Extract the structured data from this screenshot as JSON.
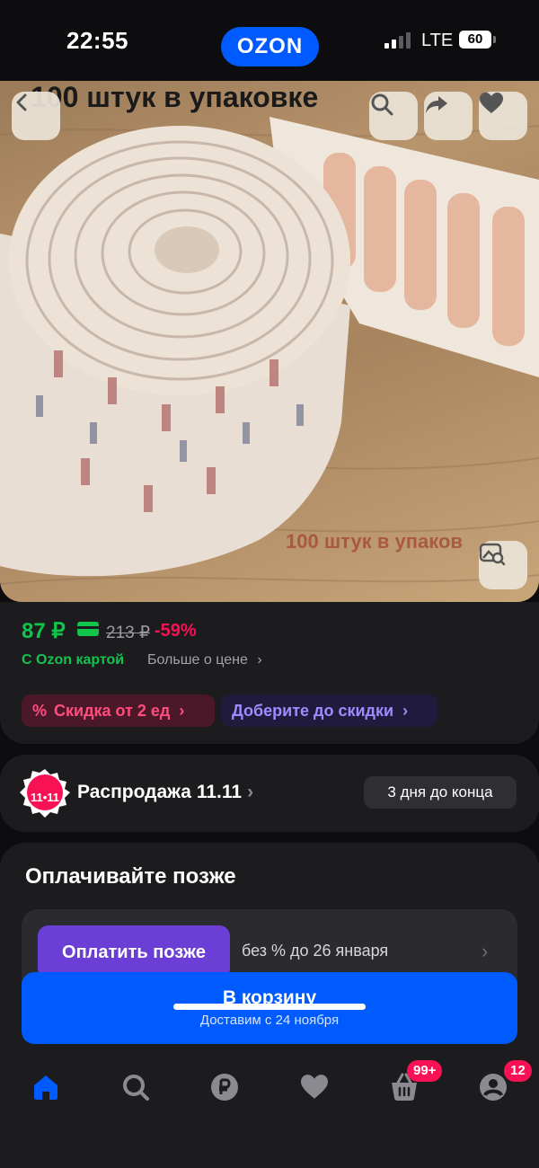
{
  "status_bar": {
    "time": "22:55",
    "brand": "OZON",
    "network": "LTE",
    "battery": "60"
  },
  "image": {
    "caption_top": "100 штук в упаковке",
    "caption_bottom": "100 штук в упаков"
  },
  "price": {
    "current": "87 ₽",
    "old": "213 ₽",
    "discount": "-59%",
    "card_label": "С Ozon картой",
    "more_label": "Больше о цене"
  },
  "chips": {
    "discount": "Скидка от 2 ед",
    "add_more": "Доберите до скидки"
  },
  "sale": {
    "badge": "11•11",
    "title": "Распродажа 11.11",
    "days_left": "3 дня до конца"
  },
  "pay_later": {
    "title": "Оплачивайте позже",
    "button": "Оплатить позже",
    "note": "без % до 26 января"
  },
  "cart": {
    "label": "В корзину",
    "delivery": "Доставим с 24 ноября"
  },
  "tabbar": {
    "cart_badge": "99+",
    "profile_badge": "12"
  },
  "colors": {
    "accent": "#005bff",
    "price_green": "#10c44c",
    "discount_pink": "#f91155",
    "pay_purple": "#6b3fd6"
  }
}
